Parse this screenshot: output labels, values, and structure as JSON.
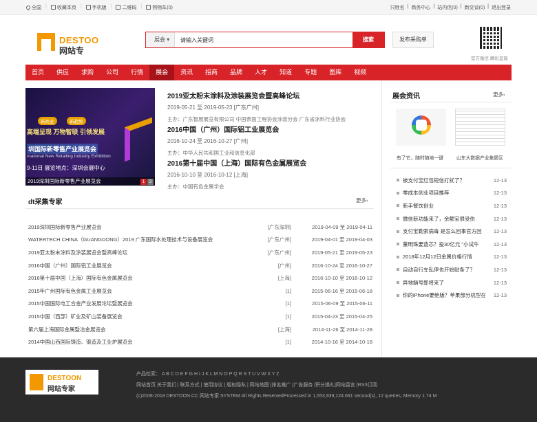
{
  "topbar": {
    "left": [
      "全国",
      "收藏本页",
      "手机版",
      "二维码",
      "购物车(0)"
    ],
    "right": [
      "只姓名",
      "商务中心",
      "站内信(0)",
      "新交谈(0)",
      "退出登录"
    ]
  },
  "logo": {
    "en": "DESTOO",
    "cn": "网站专"
  },
  "search": {
    "category": "展会",
    "placeholder": "请输入关键词",
    "button": "搜索",
    "publish": "发布采购单"
  },
  "qr_caption": "官方微信 精彩呈现",
  "nav": [
    "首页",
    "供应",
    "求购",
    "公司",
    "行情",
    "展会",
    "资讯",
    "招商",
    "品牌",
    "人才",
    "知道",
    "专题",
    "图库",
    "视频"
  ],
  "nav_active": "展会",
  "banner": {
    "tags": [
      "新商业",
      "新趋势"
    ],
    "slogan": "高端呈现 万物智联 引领发展",
    "title": "圳国际新零售产业展览会",
    "subtitle": "rnational New Retailing Industry Exhibition",
    "info": "9-11日  展览地点：深圳会展中心",
    "caption": "2019深圳国际新零售产业展览会",
    "pages": [
      "1",
      "2"
    ]
  },
  "featured": [
    {
      "title": "2019亚太粉末涂料及涂装展览会暨高峰论坛",
      "dates": "2019-05-21 至 2019-05-23 [广东广州]",
      "host": "主办：广东智展展览有限公司 中国表面工程协会涂装分会 广东省涂料行业协会"
    },
    {
      "title": "2016中国（广州）国际铝工业展览会",
      "dates": "2016-10-24 至 2016-10-27 [广州]",
      "host": "主办：中华人民共和国工业和信息化部"
    },
    {
      "title": "2016第十届中国（上海）国际有色金属展览会",
      "dates": "2016-10-10 至 2016-10-12 [上海]",
      "host": "主办：中国有色金属学会"
    }
  ],
  "dt": {
    "title": "dt采集专家",
    "more": "更多›"
  },
  "expo_list": [
    {
      "name": "2019深圳国际新零售产业展览会",
      "city": "[广东深圳]",
      "date": "2019-04-09 至 2019-04-11"
    },
    {
      "name": "WATERTECH CHINA（GUANGDONG）2019 广东国际水处理技术与设备展览会",
      "city": "[广东广州]",
      "date": "2019-04-01 至 2019-04-03"
    },
    {
      "name": "2019亚太粉末涂料及涂装展览会暨高峰论坛",
      "city": "[广东广州]",
      "date": "2019-05-21 至 2019-05-23"
    },
    {
      "name": "2016中国（广州）国际铝工业展览会",
      "city": "[广州]",
      "date": "2016-10-24 至 2016-10-27"
    },
    {
      "name": "2016第十届中国（上海）国际有色金属展览会",
      "city": "[上海]",
      "date": "2016-10-10 至 2016-10-12"
    },
    {
      "name": "2015年广州国际有色金属工业展览会",
      "city": "[1]",
      "date": "2015-06-16 至 2015-06-18"
    },
    {
      "name": "2015中国国际电工合金产业发展论坛暨展览会",
      "city": "[1]",
      "date": "2015-06-09 至 2015-06-11"
    },
    {
      "name": "2015中国（西部）矿业及矿山装备展览会",
      "city": "[1]",
      "date": "2015-04-23 至 2015-04-25"
    },
    {
      "name": "第六届上海国际金属暨冶金展览会",
      "city": "[上海]",
      "date": "2014-11-26 至 2014-11-28"
    },
    {
      "name": "2014中国山西国际铸造、锻造及工业炉展览会",
      "city": "[1]",
      "date": "2014-10-16 至 2014-10-18"
    }
  ],
  "side": {
    "title": "展会资讯",
    "more": "更多›",
    "thumbs": [
      "有了它，随时随地一键",
      "山东大数据产业集聚区"
    ],
    "news": [
      {
        "t": "被支付宝红包短信打扰了？",
        "d": "12-13"
      },
      {
        "t": "零成本创业项目推荐",
        "d": "12-13"
      },
      {
        "t": "新手餐饮创业",
        "d": "12-13"
      },
      {
        "t": "微信新功能来了，余额宝很受伤",
        "d": "12-13"
      },
      {
        "t": "支付宝勒索病毒 是怎么回事官方回",
        "d": "12-13"
      },
      {
        "t": "董明珠要造芯？投30亿元 \"小试牛",
        "d": "12-13"
      },
      {
        "t": "2018年12月12日金属价格行情",
        "d": "12-13"
      },
      {
        "t": "自动自行车乱停也开始贴条了？",
        "d": "12-13"
      },
      {
        "t": "异地銷号即将来了",
        "d": "12-13"
      },
      {
        "t": "你的iPhone要绝版？苹果部分机型在",
        "d": "12-13"
      }
    ]
  },
  "footer": {
    "logo_en": "DESTOON",
    "logo_cn": "网站专家",
    "index": "产品检索： A B C D E F G H I J K L M N O P Q R S T U V W X Y Z",
    "links": "网站首页 关于我们 | 联系方式 | 使用协议 | 版权隐私 | 网站地图 |排名推广 |广告服务 |积分换礼|网站留言 |RSS订阅",
    "copyright": "(c)2008-2018 DESTOON.CC 网站专家 SYSTEM All Rights ReservedProcessed in 1,553,939,124.691 second(s), 12 queries, Memory 1.74 M"
  }
}
